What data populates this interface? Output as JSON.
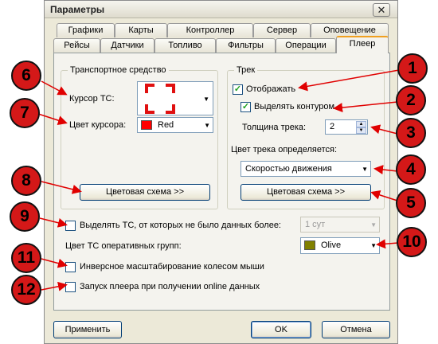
{
  "window": {
    "title": "Параметры",
    "close_glyph": "✕"
  },
  "tabs_row1": [
    "Графики",
    "Карты",
    "Контроллер",
    "Сервер",
    "Оповещение"
  ],
  "tabs_row2": [
    "Рейсы",
    "Датчики",
    "Топливо",
    "Фильтры",
    "Операции",
    "Плеер"
  ],
  "vehicle_group": {
    "title": "Транспортное средство",
    "cursor_label": "Курсор ТС:",
    "cursor_color_label": "Цвет курсора:",
    "cursor_color_value": "Red",
    "cursor_color_hex": "#ff0000",
    "color_scheme_button": "Цветовая схема >>"
  },
  "track_group": {
    "title": "Трек",
    "show_label": "Отображать",
    "show_checked": true,
    "outline_label": "Выделять контуром",
    "outline_checked": true,
    "thickness_label": "Толщина трека:",
    "thickness_value": "2",
    "color_defined_label": "Цвет трека определяется:",
    "color_defined_value": "Скоростью движения",
    "color_scheme_button": "Цветовая схема >>"
  },
  "highlight_no_data": {
    "label": "Выделять ТС, от которых не было данных более:",
    "value": "1 сут"
  },
  "operative_groups": {
    "label": "Цвет ТС оперативных групп:",
    "value": "Olive",
    "color_hex": "#808000"
  },
  "inverse_zoom_label": "Инверсное масштабирование колесом мыши",
  "player_online_label": "Запуск плеера при получении online данных",
  "buttons": {
    "apply": "Применить",
    "ok": "OK",
    "cancel": "Отмена"
  },
  "markers": [
    "1",
    "2",
    "3",
    "4",
    "5",
    "6",
    "7",
    "8",
    "9",
    "10",
    "11",
    "12"
  ]
}
